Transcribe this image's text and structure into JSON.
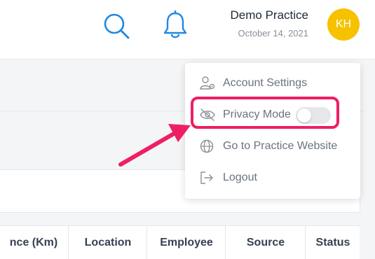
{
  "header": {
    "practice_name": "Demo Practice",
    "date": "October 14, 2021",
    "avatar_initials": "KH",
    "accent_color": "#1e88e5",
    "avatar_color": "#f6c200"
  },
  "menu": {
    "items": [
      {
        "label": "Account Settings",
        "icon": "user-settings-icon"
      },
      {
        "label": "Privacy Mode",
        "icon": "eye-off-icon",
        "toggle_on": false
      },
      {
        "label": "Go to Practice Website",
        "icon": "globe-icon"
      },
      {
        "label": "Logout",
        "icon": "logout-icon"
      }
    ]
  },
  "table": {
    "headers": [
      "nce (Km)",
      "Location",
      "Employee",
      "Source",
      "Status"
    ]
  },
  "annotation": {
    "color": "#ee1f63"
  }
}
